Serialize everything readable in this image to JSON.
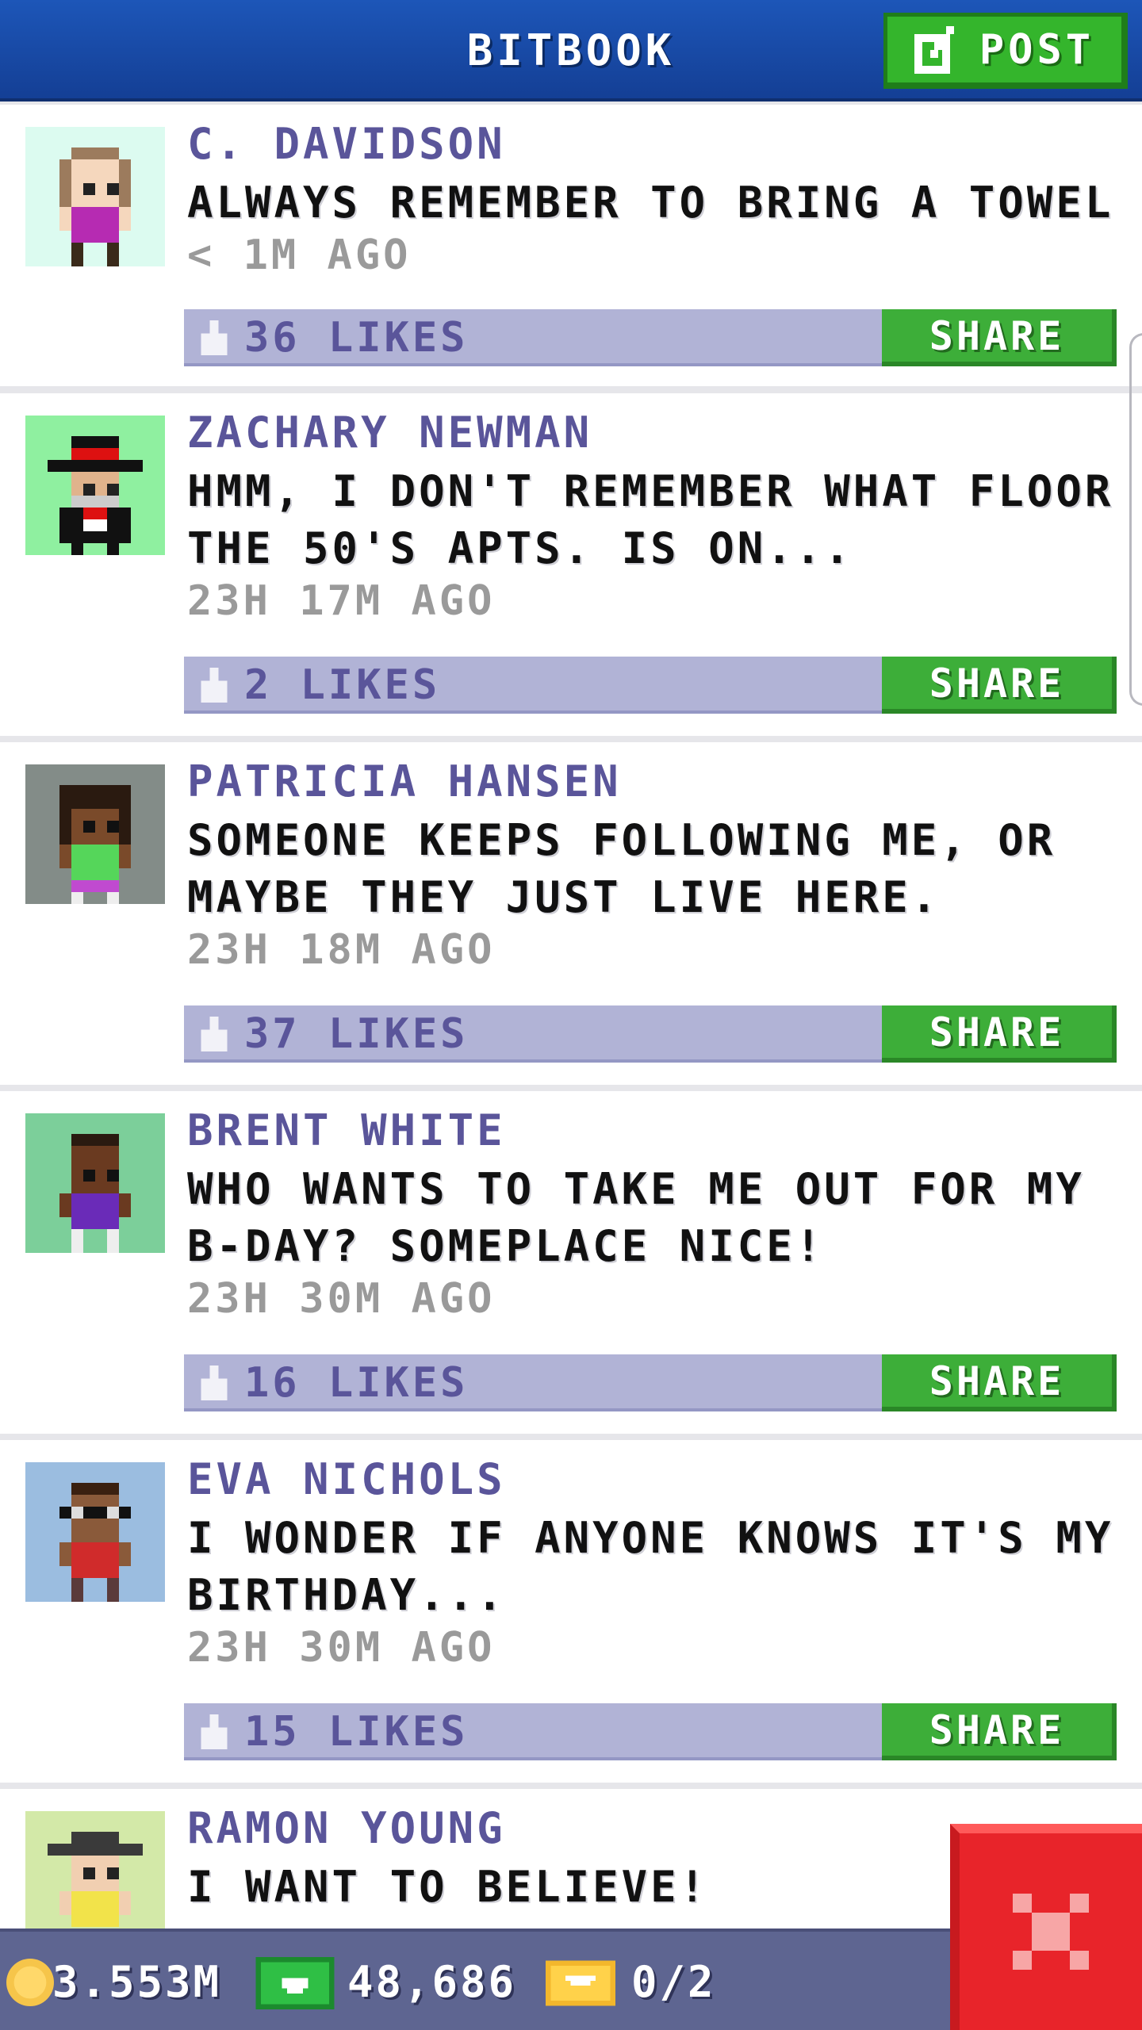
{
  "header": {
    "title": "BITBOOK",
    "post_label": "POST"
  },
  "posts": [
    {
      "name": "C. DAVIDSON",
      "message": "ALWAYS REMEMBER TO BRING A TOWEL",
      "time": "< 1M AGO",
      "likes": "36 LIKES",
      "share": "SHARE",
      "avatar_bg": "#dcfbf0"
    },
    {
      "name": "ZACHARY NEWMAN",
      "message": "HMM, I DON'T REMEMBER WHAT FLOOR THE 50'S APTS. IS ON...",
      "time": "23H 17M AGO",
      "likes": "2 LIKES",
      "share": "SHARE",
      "avatar_bg": "#8ff0a0"
    },
    {
      "name": "PATRICIA HANSEN",
      "message": "SOMEONE KEEPS FOLLOWING ME, OR MAYBE THEY JUST LIVE HERE.",
      "time": "23H 18M AGO",
      "likes": "37 LIKES",
      "share": "SHARE",
      "avatar_bg": "#838c88"
    },
    {
      "name": "BRENT WHITE",
      "message": "WHO WANTS TO TAKE ME OUT FOR MY B-DAY? SOMEPLACE NICE!",
      "time": "23H 30M AGO",
      "likes": "16 LIKES",
      "share": "SHARE",
      "avatar_bg": "#7ccf9a"
    },
    {
      "name": "EVA NICHOLS",
      "message": "I WONDER IF ANYONE KNOWS IT'S MY BIRTHDAY...",
      "time": "23H 30M AGO",
      "likes": "15 LIKES",
      "share": "SHARE",
      "avatar_bg": "#9bbde0"
    },
    {
      "name": "RAMON YOUNG",
      "message": "I WANT TO BELIEVE!",
      "time": "",
      "likes": "",
      "share": "",
      "avatar_bg": "#d3e9a8"
    }
  ],
  "footer": {
    "coins": "3.553M",
    "bux": "48,686",
    "tickets": "0/2"
  },
  "colors": {
    "header": "#1a4fae",
    "post_button": "#34b52c",
    "like_bar": "#b1b3d6",
    "share_button": "#3dae39",
    "name_text": "#5a559a",
    "footer": "#5e6591",
    "close_button": "#e8242a"
  },
  "icons": {
    "post": "edit-icon",
    "like": "thumbs-up-icon",
    "coin": "coin-icon",
    "bux": "bux-icon",
    "ticket": "ticket-icon",
    "close": "close-icon"
  }
}
